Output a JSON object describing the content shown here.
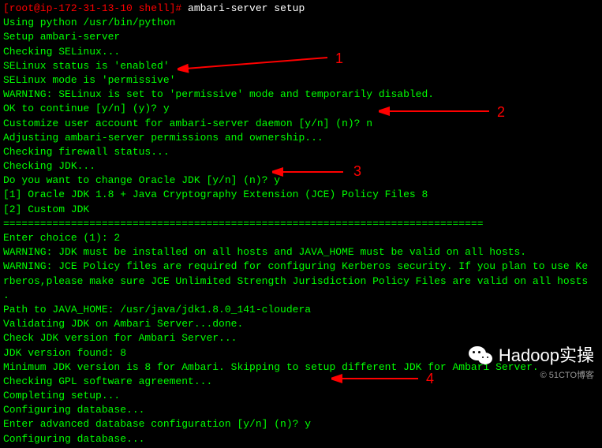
{
  "prompt": {
    "user_host": "[root@ip-172-31-13-10 shell]# ",
    "command": "ambari-server setup"
  },
  "lines": {
    "l1": "Using python  /usr/bin/python",
    "l2": "Setup ambari-server",
    "l3": "Checking SELinux...",
    "l4": "SELinux status is 'enabled'",
    "l5": "SELinux mode is 'permissive'",
    "l6": "WARNING: SELinux is set to 'permissive' mode and temporarily disabled.",
    "l7": "OK to continue [y/n] (y)? y",
    "l8": "Customize user account for ambari-server daemon [y/n] (n)? n",
    "l9": "Adjusting ambari-server permissions and ownership...",
    "l10": "Checking firewall status...",
    "l11": "Checking JDK...",
    "l12": "Do you want to change Oracle JDK [y/n] (n)? y",
    "l13": "[1] Oracle JDK 1.8 + Java Cryptography Extension (JCE) Policy Files 8",
    "l14": "[2] Custom JDK",
    "l15": "==============================================================================",
    "l16": "Enter choice (1): 2",
    "l17": "WARNING: JDK must be installed on all hosts and JAVA_HOME must be valid on all hosts.",
    "l18": "WARNING: JCE Policy files are required for configuring Kerberos security. If you plan to use Ke",
    "l19": "rberos,please make sure JCE Unlimited Strength Jurisdiction Policy Files are valid on all hosts",
    "l20": ".",
    "l21": "Path to JAVA_HOME: /usr/java/jdk1.8.0_141-cloudera",
    "l22": "Validating JDK on Ambari Server...done.",
    "l23": "Check JDK version for Ambari Server...",
    "l24": "JDK version found: 8",
    "l25": "Minimum JDK version is 8 for Ambari. Skipping to setup different JDK for Ambari Server.",
    "l26": "Checking GPL software agreement...",
    "l27": "Completing setup...",
    "l28": "Configuring database...",
    "l29": "Enter advanced database configuration [y/n] (n)? y",
    "l30": "Configuring database..."
  },
  "annotations": {
    "a1": "1",
    "a2": "2",
    "a3": "3",
    "a4": "4"
  },
  "watermark": {
    "main": "Hadoop实操",
    "sub": "© 51CTO博客"
  }
}
